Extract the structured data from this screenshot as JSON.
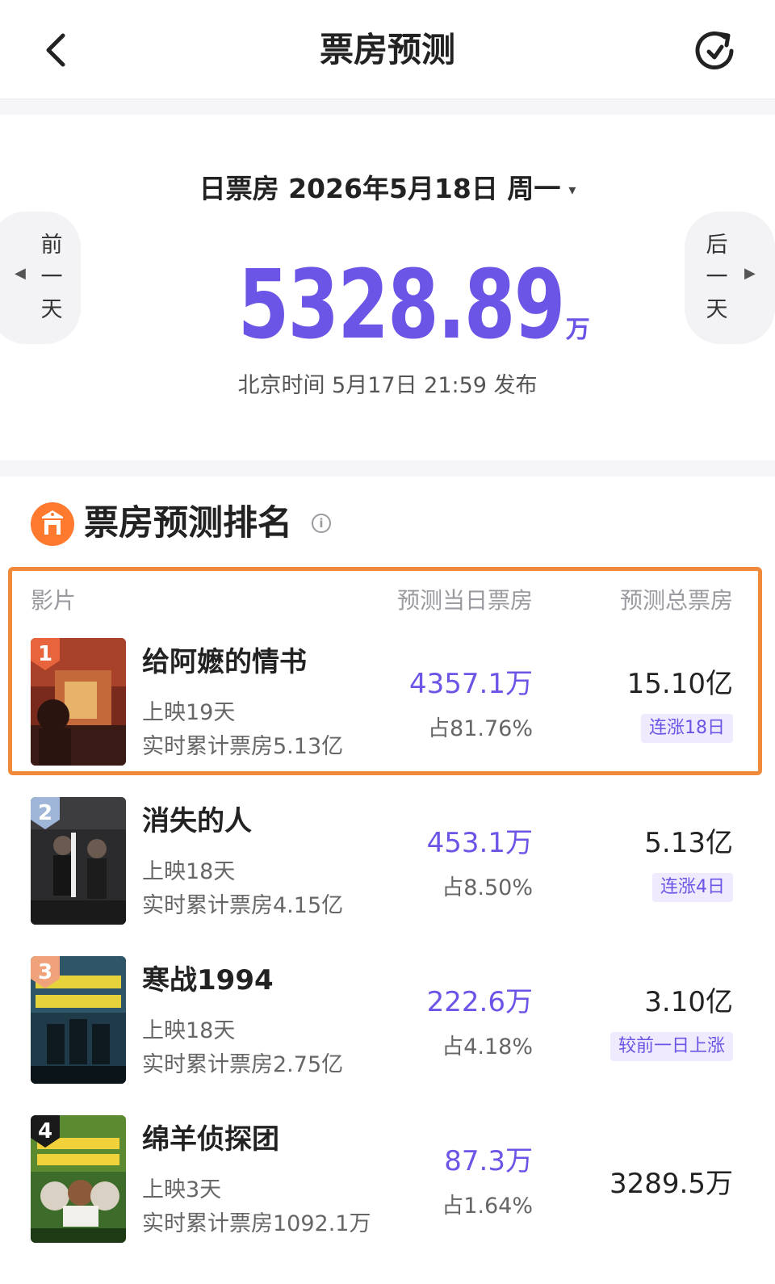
{
  "header": {
    "title": "票房预测",
    "back_icon": "chevron-left-icon",
    "refresh_icon": "refresh-icon"
  },
  "summary": {
    "date_label": "日票房 2026年5月18日 周一",
    "caret": "▾",
    "prev_label": [
      "前",
      "一",
      "天"
    ],
    "next_label": [
      "后",
      "一",
      "天"
    ],
    "prev_arrow": "◀",
    "next_arrow": "▶",
    "value": "5328.89",
    "unit": "万",
    "publish_text": "北京时间 5月17日 21:59 发布"
  },
  "ranking": {
    "title": "票房预测排名",
    "info_glyph": "i",
    "columns": {
      "film": "影片",
      "day": "预测当日票房",
      "total": "预测总票房"
    },
    "items": [
      {
        "rank": "1",
        "title": "给阿嬷的情书",
        "days": "上映19天",
        "cumulative": "实时累计票房5.13亿",
        "day_box": "4357.1万",
        "share": "占81.76%",
        "total": "15.10亿",
        "trend": "连涨18日"
      },
      {
        "rank": "2",
        "title": "消失的人",
        "days": "上映18天",
        "cumulative": "实时累计票房4.15亿",
        "day_box": "453.1万",
        "share": "占8.50%",
        "total": "5.13亿",
        "trend": "连涨4日"
      },
      {
        "rank": "3",
        "title": "寒战1994",
        "days": "上映18天",
        "cumulative": "实时累计票房2.75亿",
        "day_box": "222.6万",
        "share": "占4.18%",
        "total": "3.10亿",
        "trend": "较前一日上涨"
      },
      {
        "rank": "4",
        "title": "绵羊侦探团",
        "days": "上映3天",
        "cumulative": "实时累计票房1092.1万",
        "day_box": "87.3万",
        "share": "占1.64%",
        "total": "3289.5万",
        "trend": ""
      }
    ]
  },
  "colors": {
    "accent": "#6b55e6",
    "highlight": "#f08a3a",
    "rank_icon": "#ff7a2f",
    "badge_1": "#e8643c",
    "badge_2": "#9fb6d9",
    "badge_3": "#f0a37a",
    "badge_4": "#1a1a1a"
  }
}
